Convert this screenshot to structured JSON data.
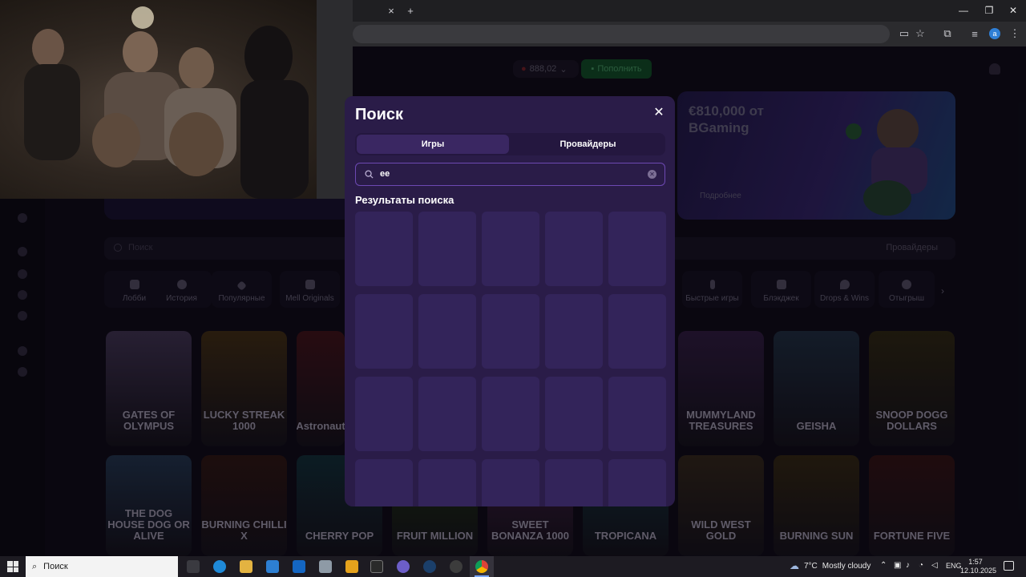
{
  "browser": {
    "new_tab_label": "+",
    "tab_close_glyph": "×",
    "window_controls": [
      "—",
      "❐",
      "✕"
    ],
    "profile_initial": "a"
  },
  "site": {
    "balance": "888,02",
    "topup_label": "Пополнить",
    "banner_title": "€810,000 от BGaming",
    "banner_button": "Подробнее",
    "search_placeholder": "Поиск",
    "providers_label": "Провайдеры",
    "categories": [
      {
        "label": "Лобби",
        "icon": "grid-icon"
      },
      {
        "label": "История",
        "icon": "clock-icon"
      },
      {
        "label": "Популярные",
        "icon": "diamond-icon"
      },
      {
        "label": "Mell Originals",
        "icon": "m-logo-icon"
      },
      {
        "label": "Быстрые игры",
        "icon": "bolt-icon"
      },
      {
        "label": "Блэкджек",
        "icon": "cards-icon"
      },
      {
        "label": "Drops & Wins",
        "icon": "drop-icon"
      },
      {
        "label": "Отыгрыш",
        "icon": "coin-icon"
      }
    ],
    "games_row1": [
      {
        "name": "GATES OF OLYMPUS",
        "color": "#3a2f4a"
      },
      {
        "name": "LUCKY STREAK 1000",
        "color": "#3b2a12"
      },
      {
        "name": "Astronaut",
        "color": "#3a1216"
      },
      {
        "name": "MUMMYLAND TREASURES",
        "color": "#2b1a3a"
      },
      {
        "name": "GEISHA",
        "color": "#1c2a3a"
      },
      {
        "name": "SNOOP DOGG DOLLARS",
        "color": "#2a2410"
      }
    ],
    "games_row2": [
      {
        "name": "THE DOG HOUSE DOG OR ALIVE",
        "color": "#1f3046"
      },
      {
        "name": "BURNING CHILLI X",
        "color": "#2a1410"
      },
      {
        "name": "CHERRY POP",
        "color": "#102a32"
      },
      {
        "name": "FRUIT MILLION",
        "color": "#1c3010"
      },
      {
        "name": "SWEET BONANZA 1000",
        "color": "#3a1a3a"
      },
      {
        "name": "TROPICANA",
        "color": "#103038"
      },
      {
        "name": "WILD WEST GOLD",
        "color": "#2e2418"
      },
      {
        "name": "BURNING SUN",
        "color": "#2e2410"
      },
      {
        "name": "FORTUNE FIVE",
        "color": "#2e1212"
      }
    ]
  },
  "modal": {
    "title": "Поиск",
    "close_glyph": "✕",
    "tabs": [
      {
        "label": "Игры",
        "active": true
      },
      {
        "label": "Провайдеры",
        "active": false
      }
    ],
    "search_value": "ee",
    "results_heading": "Результаты поиска",
    "placeholder_cards": 20
  },
  "taskbar": {
    "search_label": "Поиск",
    "weather_temp": "7°C",
    "weather_text": "Mostly cloudy",
    "language": "ENG",
    "time": "1:57",
    "date": "12.10.2025"
  },
  "colors": {
    "modal_bg": "#2a1c48",
    "accent": "#6d49b3",
    "topup": "#0f4522"
  }
}
